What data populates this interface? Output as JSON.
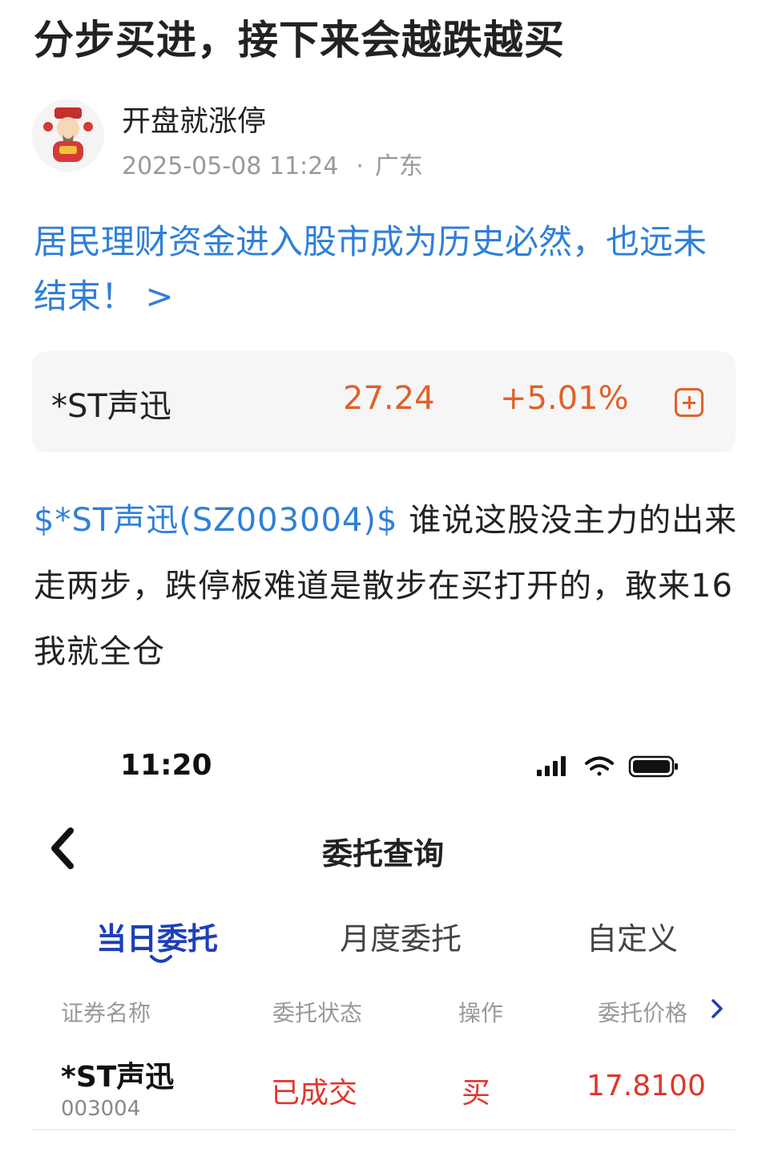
{
  "post": {
    "title": "分步买进，接下来会越跌越买",
    "author": "开盘就涨停",
    "datetime": "2025-05-08 11:24",
    "location": "广东",
    "topic": "居民理财资金进入股市成为历史必然，也远未结束！ >",
    "body_cashtag": "$*ST声迅(SZ003004)$",
    "body_text": " 谁说这股没主力的出来走两步，跌停板难道是散步在买打开的，敢来16我就全仓"
  },
  "stock_card": {
    "name": "*ST声迅",
    "price": "27.24",
    "change": "+5.01%",
    "accent_color": "#e0612a",
    "icon": "add-square-icon"
  },
  "screenshot": {
    "time": "11:20",
    "status_icons": [
      "signal-icon",
      "wifi-icon",
      "battery-icon"
    ],
    "nav_title": "委托查询",
    "tabs": [
      {
        "label": "当日委托",
        "active": true
      },
      {
        "label": "月度委托",
        "active": false
      },
      {
        "label": "自定义",
        "active": false
      }
    ],
    "columns": [
      "证券名称",
      "委托状态",
      "操作",
      "委托价格"
    ],
    "row": {
      "name": "*ST声迅",
      "code": "003004",
      "status": "已成交",
      "action": "买",
      "price": "17.8100"
    },
    "active_color": "#1c3fb8",
    "red_color": "#e0362b"
  }
}
